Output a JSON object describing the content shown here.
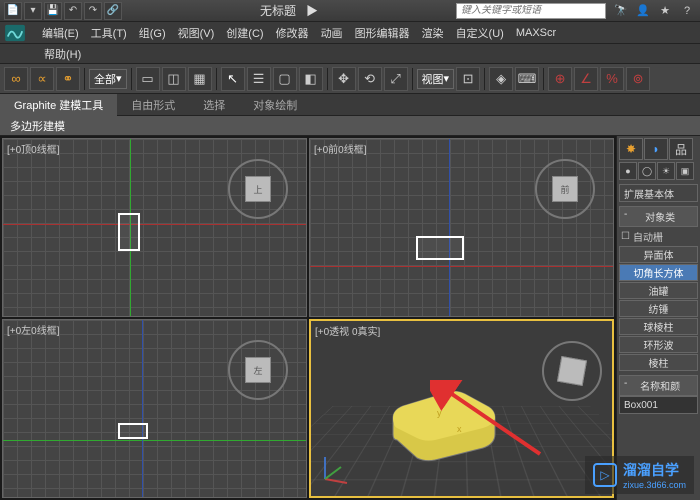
{
  "titlebar": {
    "title": "无标题",
    "search_placeholder": "键入关键字或短语"
  },
  "menubar": {
    "items": [
      "编辑(E)",
      "工具(T)",
      "组(G)",
      "视图(V)",
      "创建(C)",
      "修改器",
      "动画",
      "图形编辑器",
      "渲染",
      "自定义(U)",
      "MAXScr"
    ],
    "row2": [
      "帮助(H)"
    ]
  },
  "toolbar": {
    "set_dropdown": "全部",
    "view_dropdown": "视图"
  },
  "ribbon": {
    "tabs": [
      "Graphite 建模工具",
      "自由形式",
      "选择",
      "对象绘制"
    ],
    "panel_label": "多边形建模"
  },
  "viewports": {
    "top_label": "[+0顶0线框]",
    "front_label": "[+0前0线框]",
    "left_label": "[+0左0线框]",
    "persp_label": "[+0透视 0真实]",
    "gizmo_top": "上",
    "gizmo_front": "前",
    "gizmo_left": "左",
    "axis_x": "x",
    "axis_y": "y"
  },
  "cmd_panel": {
    "category_dropdown": "扩展基本体",
    "section_object_type": "对象类",
    "auto_grid": "自动栅",
    "buttons": [
      "异面体",
      "切角长方体",
      "油罐",
      "纺锤",
      "球棱柱",
      "环形波",
      "棱柱"
    ],
    "selected_index": 1,
    "name_section": "名称和颜",
    "object_name": "Box001"
  },
  "watermark": {
    "brand": "溜溜自学",
    "url": "zixue.3d66.com"
  }
}
